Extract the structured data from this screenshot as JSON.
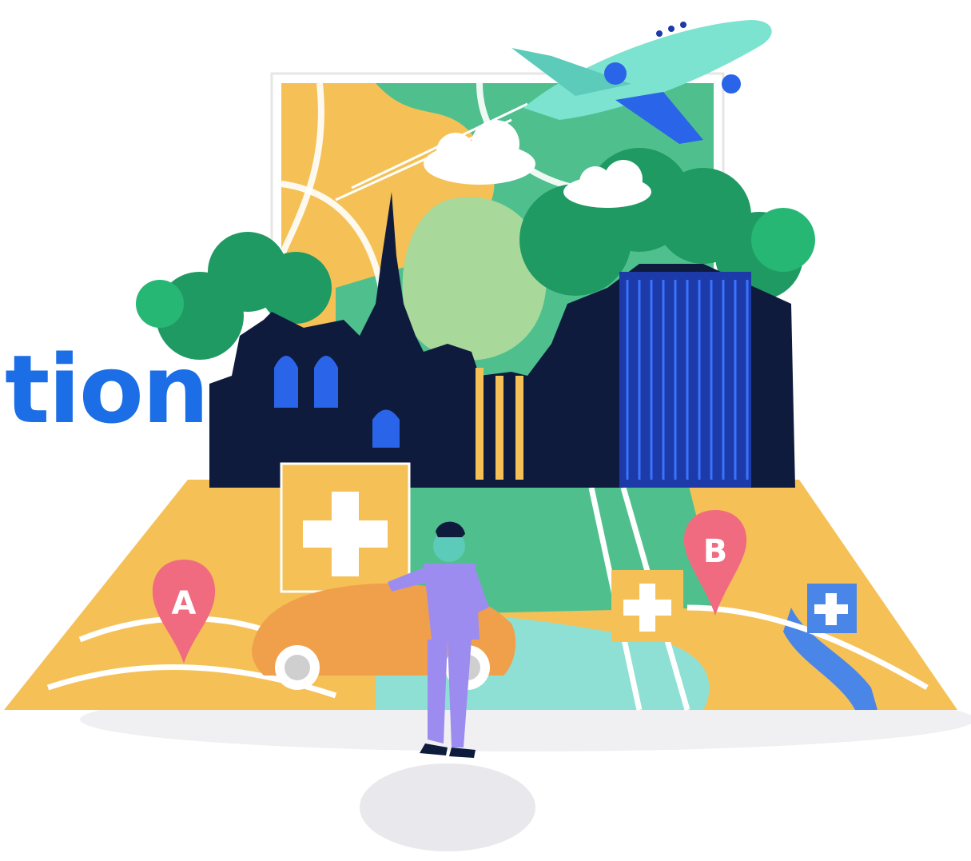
{
  "headline": {
    "text": "tion"
  },
  "markers": {
    "a_label": "A",
    "b_label": "B"
  },
  "palette": {
    "headline": "#1b6ee6",
    "map_yellow": "#f5c156",
    "map_green": "#4fc08d",
    "map_teal": "#8fe0d4",
    "river_blue": "#4a86e8",
    "skyline_navy": "#0f1b3d",
    "tree_green": "#1f9a63",
    "plane_mint": "#7be3cf",
    "marker_pink": "#f06b7f",
    "car_orange": "#f0a04b",
    "person_purple": "#9c8cf0"
  },
  "icons": [
    "airplane-icon",
    "cloud-icon",
    "tree-icon",
    "cathedral-icon",
    "building-icon",
    "pin-a-icon",
    "pin-b-icon",
    "plus-icon",
    "car-icon",
    "person-icon"
  ]
}
